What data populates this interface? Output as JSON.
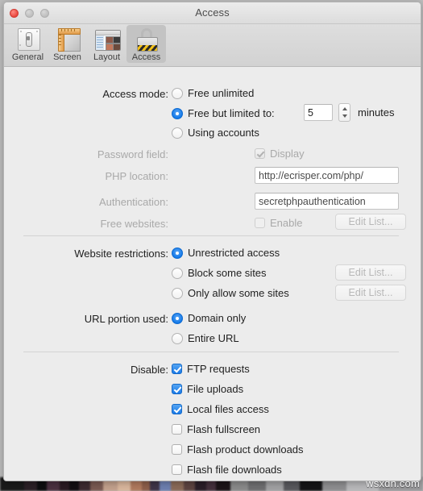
{
  "window": {
    "title": "Access",
    "traffic_lights": [
      "close",
      "minimize",
      "zoom"
    ]
  },
  "toolbar": {
    "items": [
      {
        "label": "General",
        "icon": "device-panel-icon",
        "selected": false
      },
      {
        "label": "Screen",
        "icon": "ruler-screen-icon",
        "selected": false
      },
      {
        "label": "Layout",
        "icon": "window-layout-icon",
        "selected": false
      },
      {
        "label": "Access",
        "icon": "padlock-icon",
        "selected": true
      }
    ]
  },
  "sections": {
    "access_mode": {
      "label": "Access mode:",
      "options": [
        {
          "label": "Free unlimited",
          "selected": false
        },
        {
          "label": "Free but limited to:",
          "selected": true
        },
        {
          "label": "Using accounts",
          "selected": false
        }
      ],
      "minutes_value": "5",
      "minutes_unit": "minutes",
      "stepper_icon": "stepper-up-down-icon"
    },
    "password_field": {
      "label": "Password field:",
      "checkbox_label": "Display",
      "checked": true,
      "enabled": false
    },
    "php_location": {
      "label": "PHP location:",
      "value": "http://ecrisper.com/php/",
      "enabled": false
    },
    "authentication": {
      "label": "Authentication:",
      "value": "secretphpauthentication",
      "enabled": false
    },
    "free_websites": {
      "label": "Free websites:",
      "checkbox_label": "Enable",
      "checked": false,
      "enabled": false,
      "button_label": "Edit List..."
    },
    "website_restrictions": {
      "label": "Website restrictions:",
      "options": [
        {
          "label": "Unrestricted access",
          "selected": true,
          "button_label": null
        },
        {
          "label": "Block some sites",
          "selected": false,
          "button_label": "Edit List..."
        },
        {
          "label": "Only allow some sites",
          "selected": false,
          "button_label": "Edit List..."
        }
      ]
    },
    "url_portion": {
      "label": "URL portion used:",
      "options": [
        {
          "label": "Domain only",
          "selected": true
        },
        {
          "label": "Entire URL",
          "selected": false
        }
      ]
    },
    "disable": {
      "label": "Disable:",
      "options": [
        {
          "label": "FTP requests",
          "checked": true
        },
        {
          "label": "File uploads",
          "checked": true
        },
        {
          "label": "Local files access",
          "checked": true
        },
        {
          "label": "Flash fullscreen",
          "checked": false
        },
        {
          "label": "Flash product downloads",
          "checked": false
        },
        {
          "label": "Flash file downloads",
          "checked": false
        }
      ]
    }
  },
  "watermark": "wsxdn.com",
  "colors": {
    "accent_blue": "#1a7ae8",
    "window_bg": "#ececec",
    "toolbar_bg": "#d6d6d6",
    "disabled_text": "#a9a9a9"
  }
}
